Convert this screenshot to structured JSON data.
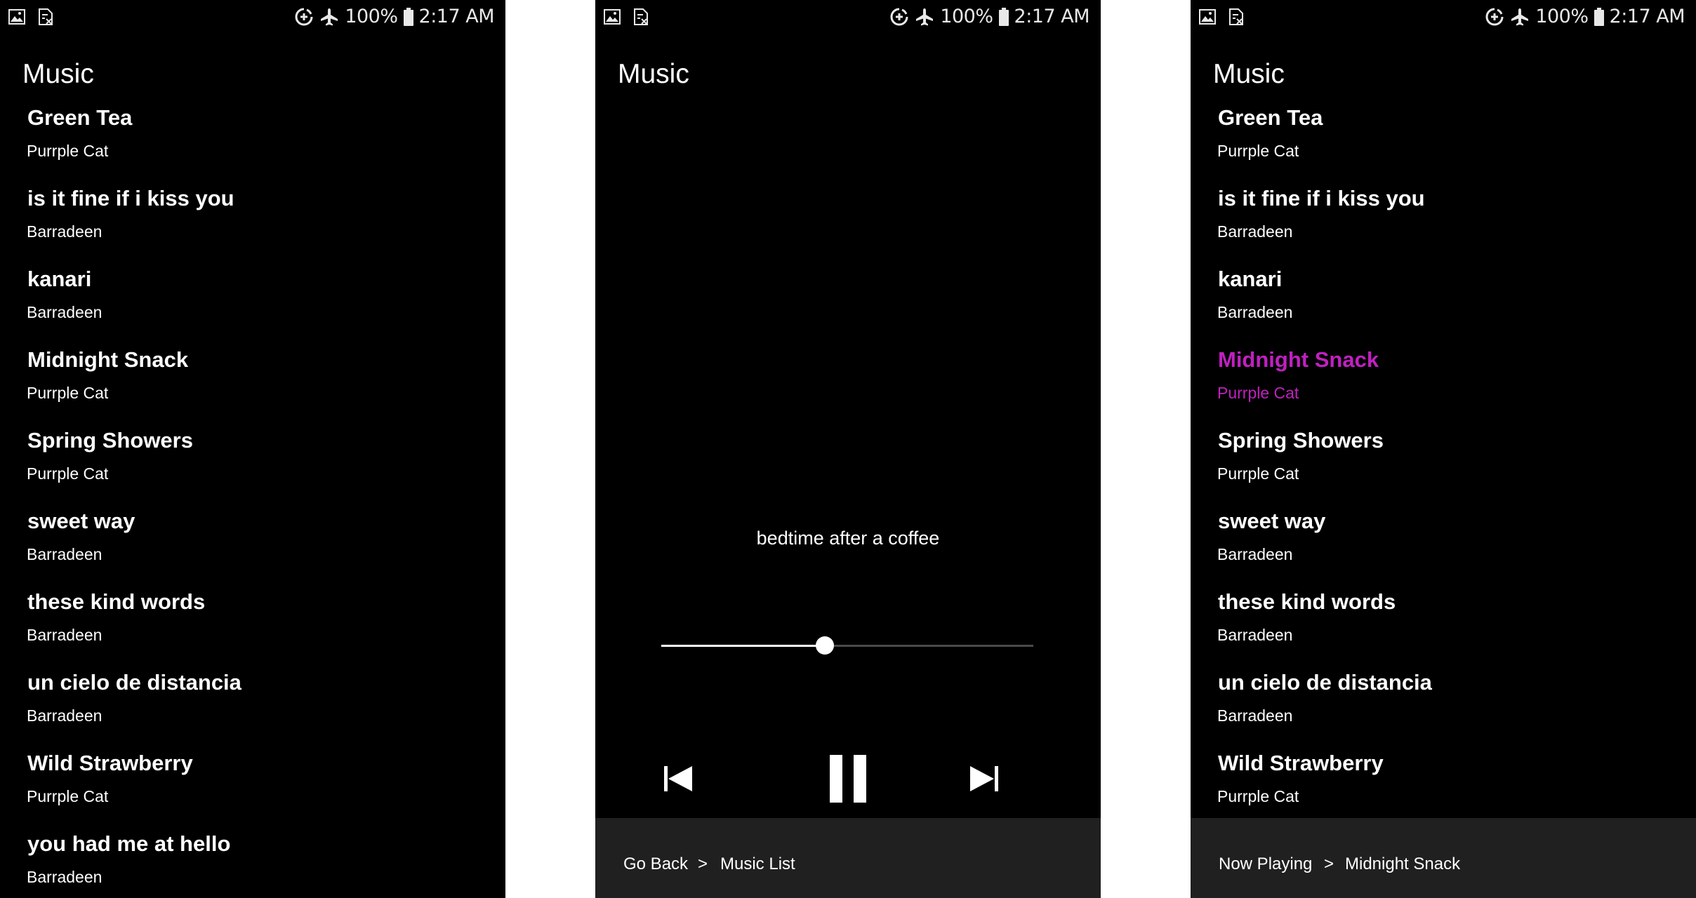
{
  "status_bar": {
    "battery": "100%",
    "time": "2:17 AM",
    "icons": [
      "image-icon",
      "no-sim-icon",
      "data-saver-icon",
      "airplane-icon",
      "battery-icon"
    ]
  },
  "app_title": "Music",
  "songs": [
    {
      "title": "Green Tea",
      "artist": "Purrple Cat"
    },
    {
      "title": "is it fine if i kiss you",
      "artist": "Barradeen"
    },
    {
      "title": "kanari",
      "artist": "Barradeen"
    },
    {
      "title": "Midnight Snack",
      "artist": "Purrple Cat"
    },
    {
      "title": "Spring Showers",
      "artist": "Purrple Cat"
    },
    {
      "title": "sweet way",
      "artist": "Barradeen"
    },
    {
      "title": "these kind words",
      "artist": "Barradeen"
    },
    {
      "title": "un cielo de distancia",
      "artist": "Barradeen"
    },
    {
      "title": "Wild Strawberry",
      "artist": "Purrple Cat"
    },
    {
      "title": "you had me at hello",
      "artist": "Barradeen"
    }
  ],
  "player": {
    "now_playing_title": "bedtime after a coffee",
    "progress": 0.44,
    "controls": [
      "previous-icon",
      "pause-icon",
      "next-icon"
    ]
  },
  "player_footer": {
    "back_label": "Go Back",
    "separator": ">",
    "current_label": "Music List"
  },
  "list_footer": {
    "label": "Now Playing",
    "separator": ">",
    "current_track": "Midnight Snack"
  },
  "highlighted_song_index": 3,
  "colors": {
    "background": "#000000",
    "text": "#ffffff",
    "highlight": "#c020c0",
    "footer": "#202020",
    "gutter": "#ffffff"
  }
}
